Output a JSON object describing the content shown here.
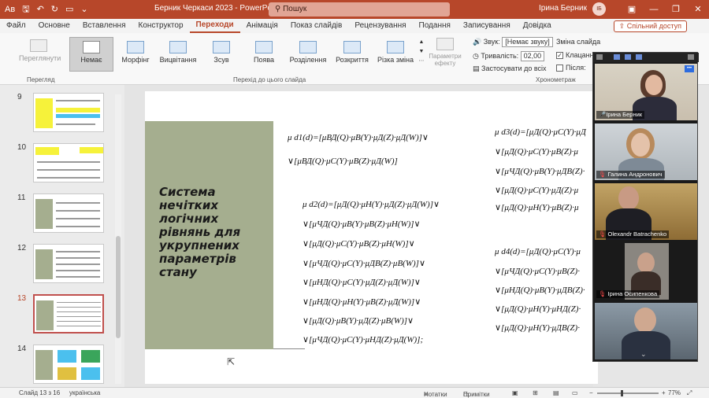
{
  "titlebar": {
    "autosave": "Ав",
    "document_title": "Берник Черкаси 2023  -  PowerPoint",
    "search_placeholder": "Пошук",
    "user_name": "Ірина Берник",
    "user_initials": "ІБ"
  },
  "menu": {
    "tabs": [
      "Файл",
      "Основне",
      "Вставлення",
      "Конструктор",
      "Переходи",
      "Анімація",
      "Показ слайдів",
      "Рецензування",
      "Подання",
      "Записування",
      "Довідка"
    ],
    "active": "Переходи",
    "share": "Спільний доступ"
  },
  "ribbon": {
    "preview": "Переглянути",
    "preview_group": "Перегляд",
    "transitions": [
      "Немає",
      "Морфінг",
      "Вицвітання",
      "Зсув",
      "Поява",
      "Розділення",
      "Розкриття",
      "Різка зміна"
    ],
    "transitions_group": "Перехід до цього слайда",
    "effect_options": "Параметри ефекту",
    "sound_label": "Звук:",
    "sound_value": "[Немає звуку]",
    "duration_label": "Тривалість:",
    "duration_value": "02,00",
    "apply_all": "Застосувати до всіх",
    "advance_label": "Зміна слайда",
    "on_click": "Клацанн",
    "after": "Після:",
    "timing_group": "Хронометраж"
  },
  "thumbnails": [
    {
      "num": "9"
    },
    {
      "num": "10"
    },
    {
      "num": "11"
    },
    {
      "num": "12"
    },
    {
      "num": "13"
    },
    {
      "num": "14"
    }
  ],
  "slide": {
    "title": "Система нечітких логічних рівнянь для укрупнених параметрів стану",
    "equations": {
      "d1_line1": "μ d1(d)=[μВД(Q)·μВ(Y)·μД(Z)·μД(W)]∨",
      "d1_line2": "∨[μВД(Q)·μС(Y)·μВ(Z)·μД(W)]",
      "d2_line1": "μ d2(d)=[μД(Q)·μН(Y)·μД(Z)·μД(W)]∨",
      "d2_line2": "∨[μЧД(Q)·μВ(Y)·μВ(Z)·μН(W)]∨",
      "d2_line3": "∨[μД(Q)·μС(Y)·μВ(Z)·μН(W)]∨",
      "d2_line4": "∨[μЧД(Q)·μС(Y)·μДВ(Z)·μВ(W)]∨",
      "d2_line5": "∨[μНД(Q)·μС(Y)·μД(Z)·μД(W)]∨",
      "d2_line6": "∨[μНД(Q)·μН(Y)·μВ(Z)·μД(W)]∨",
      "d2_line7": "∨[μД(Q)·μВ(Y)·μД(Z)·μВ(W)]∨",
      "d2_line8": "∨[μЧД(Q)·μС(Y)·μНД(Z)·μД(W)];",
      "d3_line1": "μ d3(d)=[μД(Q)·μС(Y)·μД",
      "d3_line2": "∨[μД(Q)·μС(Y)·μВ(Z)·μ",
      "d3_line3": "∨[μЧД(Q)·μВ(Y)·μДВ(Z)·",
      "d3_line4": "∨[μД(Q)·μС(Y)·μД(Z)·μ",
      "d3_line5": "∨[μД(Q)·μН(Y)·μВ(Z)·μ",
      "d4_line1": "μ d4(d)=[μД(Q)·μС(Y)·μ",
      "d4_line2": "∨[μЧД(Q)·μС(Y)·μВ(Z)·",
      "d4_line3": "∨[μНД(Q)·μВ(Y)·μДВ(Z)·",
      "d4_line4": "∨[μД(Q)·μН(Y)·μНД(Z)·",
      "d4_line5": "∨[μД(Q)·μН(Y)·μДВ(Z)·"
    }
  },
  "zoom": {
    "participants": [
      {
        "name": "Ірина Берник",
        "muted": false
      },
      {
        "name": "Галина Андронович",
        "muted": true
      },
      {
        "name": "Olexandr Batrachenko",
        "muted": true
      },
      {
        "name": "Ірина Осипенкова",
        "muted": true
      },
      {
        "name": "",
        "muted": false
      }
    ]
  },
  "status": {
    "slide_counter": "Слайд 13 з 16",
    "language": "українська",
    "notes": "Нотатки",
    "comments": "Примітки",
    "zoom_level": "77%"
  },
  "colors": {
    "accent": "#b7472a",
    "slide_green": "#a5ae8f"
  }
}
